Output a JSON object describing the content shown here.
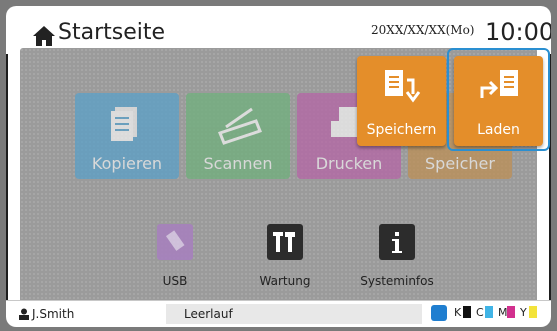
{
  "header": {
    "title": "Startseite",
    "date": "20XX/XX/XX(Mo)",
    "time": "10:00"
  },
  "tiles": [
    {
      "label": "Kopieren"
    },
    {
      "label": "Scannen"
    },
    {
      "label": "Drucken"
    },
    {
      "label": "Speicher"
    }
  ],
  "small": [
    {
      "label": "USB"
    },
    {
      "label": "Wartung"
    },
    {
      "label": "Systeminfos"
    }
  ],
  "popups": {
    "save": {
      "label": "Speichern"
    },
    "load": {
      "label": "Laden"
    }
  },
  "status": {
    "user": "J.Smith",
    "state": "Leerlauf",
    "inks": [
      {
        "letter": "K",
        "color": "#111111"
      },
      {
        "letter": "C",
        "color": "#40b4e6"
      },
      {
        "letter": "M",
        "color": "#d2308e"
      },
      {
        "letter": "Y",
        "color": "#f3e33a"
      }
    ]
  },
  "colors": {
    "accent_orange": "#e48e2a",
    "selection_blue": "#2a8fd1"
  }
}
